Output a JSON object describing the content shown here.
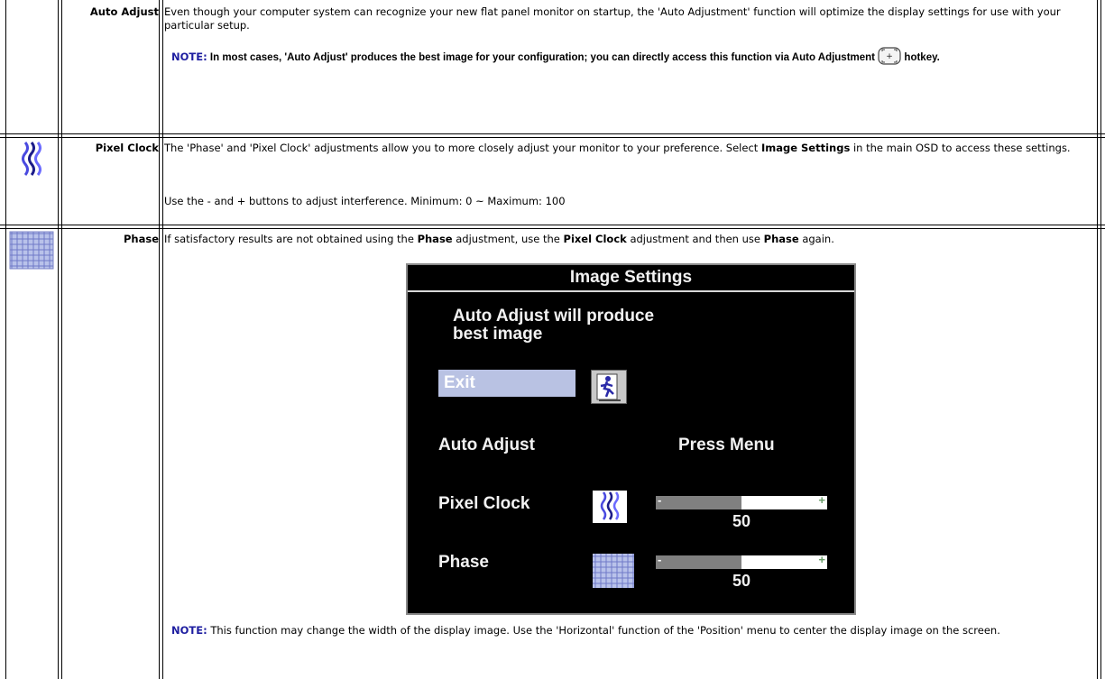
{
  "rows": {
    "auto_adjust": {
      "label": "Auto Adjust",
      "desc": "Even though your computer system can recognize your new flat panel monitor on startup, the 'Auto Adjustment' function will optimize the display settings for use with your particular setup.",
      "note_kw": "NOTE:",
      "note_text": " In most cases, 'Auto Adjust' produces the best image for your configuration; you can directly access this function via Auto Adjustment ",
      "note_after": " hotkey."
    },
    "pixel_clock": {
      "label": "Pixel Clock",
      "desc_1": "The 'Phase' and 'Pixel Clock' adjustments allow you to more closely adjust your monitor to your preference. Select ",
      "desc_bold": "Image Settings",
      "desc_2": " in the main OSD to access these settings.",
      "desc_line2": "Use the - and + buttons to adjust interference. Minimum: 0 ~ Maximum: 100"
    },
    "phase": {
      "label": "Phase",
      "p1": "If satisfactory results are not obtained using the ",
      "p1_b1": "Phase",
      "p2": " adjustment, use the ",
      "p2_b2": "Pixel Clock",
      "p3": " adjustment and then use ",
      "p3_b3": "Phase",
      "p4": " again.",
      "note_kw": "NOTE:",
      "note_text": " This function may change the width of the display image.  Use the 'Horizontal' function of the 'Position' menu to center the display image on the screen."
    }
  },
  "osd": {
    "title": "Image Settings",
    "message_line1": "Auto Adjust will produce",
    "message_line2": "best image",
    "exit_label": "Exit",
    "auto_adjust_label": "Auto Adjust",
    "auto_adjust_value": "Press Menu",
    "pixel_clock_label": "Pixel Clock",
    "pixel_clock_value": "50",
    "phase_label": "Phase",
    "phase_value": "50",
    "slider_minus": "-",
    "slider_plus": "+",
    "pixel_clock_level": 0.5,
    "phase_level": 0.5
  },
  "icons": {
    "pixel_clock": "wavy-lines-icon",
    "phase": "crosshatch-pattern-icon",
    "hotkey": "auto-adjust-hotkey-icon",
    "exit": "running-man-exit-icon"
  }
}
